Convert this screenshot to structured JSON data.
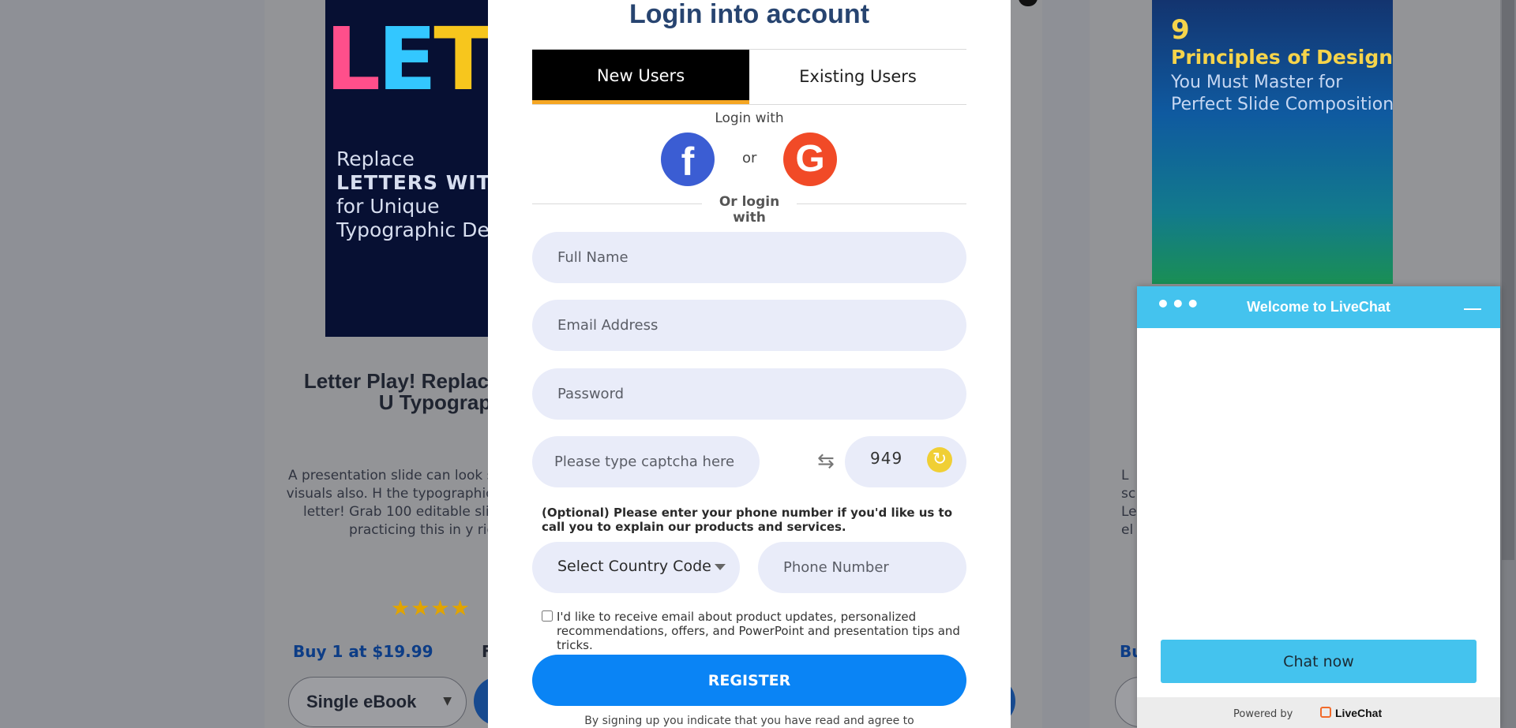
{
  "background": {
    "left_card": {
      "cover_letters": "LETT",
      "cover_lines": [
        "Replace",
        "LETTERS WITH IC",
        "for Unique",
        "Typographic De"
      ],
      "title": "Letter Play! Replac with Icons for U Typographic De",
      "description": "A presentation slide can look s great design and visuals also. H the typographic tweak of inserti a letter! Grab 100 editable slid eBook to start practicing this in y right away.",
      "stars": "★★★★",
      "price": "Buy 1 at $19.99",
      "price_partial": "F",
      "select_value": "Single eBook"
    },
    "right_card": {
      "cover_number": "9",
      "cover_title": "Principles of Design",
      "cover_lines": [
        "You Must Master for",
        "Perfect Slide Compositions"
      ],
      "text_fragment": "L\nsc\nLe\nel",
      "price_partial": "Bu"
    }
  },
  "modal": {
    "title": "Login into account",
    "tabs": [
      {
        "label": "New Users",
        "active": true
      },
      {
        "label": "Existing Users",
        "active": false
      }
    ],
    "login_with": "Login with",
    "or": "or",
    "or_login_with": "Or login with",
    "social": {
      "facebook_glyph": "f",
      "google_glyph": "G"
    },
    "fields": {
      "full_name": {
        "placeholder": "Full Name",
        "value": ""
      },
      "email": {
        "placeholder": "Email Address",
        "value": ""
      },
      "password": {
        "placeholder": "Password",
        "value": ""
      },
      "captcha": {
        "placeholder": "Please type captcha here",
        "value": ""
      },
      "phone": {
        "placeholder": "Phone Number",
        "value": ""
      }
    },
    "captcha_code": "949",
    "phone_note_bold": "(Optional)",
    "phone_note": "Please enter your phone number if you'd like us to call you to explain our products and services.",
    "country_code": "Select Country Code",
    "consent": "I'd like to receive email about product updates, personalized recommendations, offers, and PowerPoint and presentation tips and tricks.",
    "register_label": "REGISTER",
    "terms": "By signing up you indicate that you have read and agree to"
  },
  "livechat": {
    "title": "Welcome to LiveChat",
    "menu_dots": "•••",
    "chat_now": "Chat now",
    "powered_by": "Powered by",
    "brand": "LiveChat"
  },
  "colors": {
    "accent_blue": "#0a84f5",
    "tab_active_bg": "#000000",
    "tab_underline": "#f5a623",
    "facebook": "#3b5dd3",
    "google": "#f14a27",
    "livechat": "#44c3ee",
    "title": "#274470",
    "field_bg": "#e9ecf9"
  }
}
